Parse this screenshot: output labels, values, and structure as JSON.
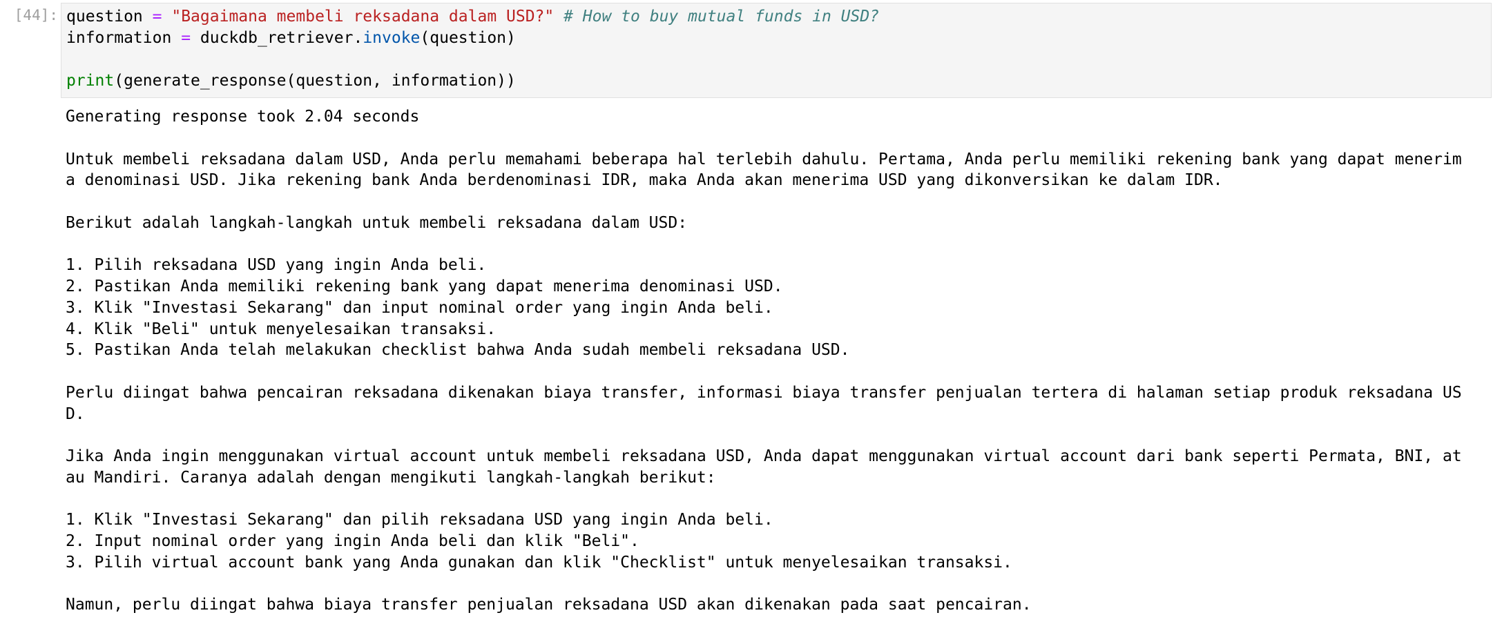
{
  "cell": {
    "prompt": "[44]:",
    "code": {
      "line1": {
        "var": "question",
        "op": "=",
        "str": "\"Bagaimana membeli reksadana dalam USD?\"",
        "comment": "# How to buy mutual funds in USD?"
      },
      "line2": {
        "var": "information",
        "op": "=",
        "obj": "duckdb_retriever.",
        "method": "invoke",
        "args": "(question)"
      },
      "line4": {
        "builtin": "print",
        "args": "(generate_response(question, information))"
      }
    },
    "output": {
      "lines": [
        "Generating response took 2.04 seconds",
        "",
        "Untuk membeli reksadana dalam USD, Anda perlu memahami beberapa hal terlebih dahulu. Pertama, Anda perlu memiliki rekening bank yang dapat menerim",
        "a denominasi USD. Jika rekening bank Anda berdenominasi IDR, maka Anda akan menerima USD yang dikonversikan ke dalam IDR.",
        "",
        "Berikut adalah langkah-langkah untuk membeli reksadana dalam USD:",
        "",
        "1. Pilih reksadana USD yang ingin Anda beli.",
        "2. Pastikan Anda memiliki rekening bank yang dapat menerima denominasi USD.",
        "3. Klik \"Investasi Sekarang\" dan input nominal order yang ingin Anda beli.",
        "4. Klik \"Beli\" untuk menyelesaikan transaksi.",
        "5. Pastikan Anda telah melakukan checklist bahwa Anda sudah membeli reksadana USD.",
        "",
        "Perlu diingat bahwa pencairan reksadana dikenakan biaya transfer, informasi biaya transfer penjualan tertera di halaman setiap produk reksadana US",
        "D.",
        "",
        "Jika Anda ingin menggunakan virtual account untuk membeli reksadana USD, Anda dapat menggunakan virtual account dari bank seperti Permata, BNI, at",
        "au Mandiri. Caranya adalah dengan mengikuti langkah-langkah berikut:",
        "",
        "1. Klik \"Investasi Sekarang\" dan pilih reksadana USD yang ingin Anda beli.",
        "2. Input nominal order yang ingin Anda beli dan klik \"Beli\".",
        "3. Pilih virtual account bank yang Anda gunakan dan klik \"Checklist\" untuk menyelesaikan transaksi.",
        "",
        "Namun, perlu diingat bahwa biaya transfer penjualan reksadana USD akan dikenakan pada saat pencairan."
      ]
    }
  }
}
